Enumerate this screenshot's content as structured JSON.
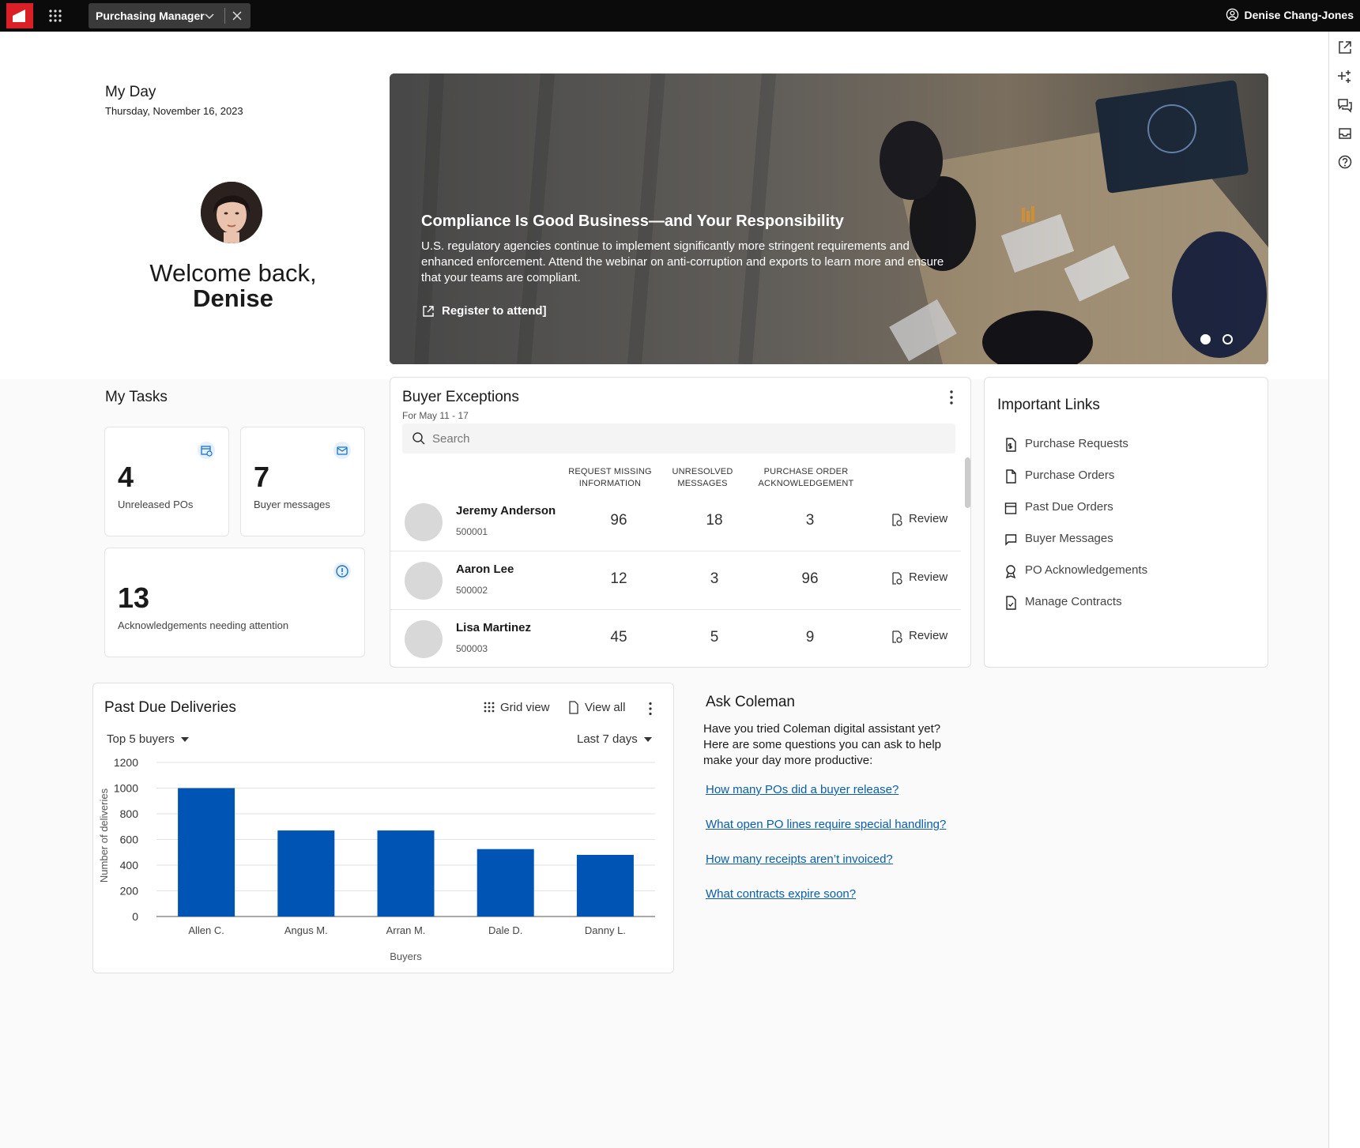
{
  "topbar": {
    "tab_label": "Purchasing Manager",
    "user_name": "Denise Chang-Jones"
  },
  "myday": {
    "title": "My Day",
    "date": "Thursday, November 16, 2023",
    "welcome_line": "Welcome back,",
    "welcome_name": "Denise"
  },
  "banner": {
    "title": "Compliance Is Good Business—and Your Responsibility",
    "body": "U.S. regulatory agencies continue to implement significantly more stringent requirements and enhanced enforcement. Attend the webinar on anti-corruption and exports to learn more and ensure that your teams are compliant.",
    "link": "Register to attend]",
    "active_slide": 1,
    "slide_count": 2
  },
  "tasks": {
    "title": "My Tasks",
    "items": [
      {
        "count": "4",
        "label": "Unreleased POs",
        "icon": "calendar-clock-icon"
      },
      {
        "count": "7",
        "label": "Buyer messages",
        "icon": "mail-icon"
      },
      {
        "count": "13",
        "label": "Acknowledgements needing attention",
        "icon": "info-icon"
      }
    ]
  },
  "buyer_exceptions": {
    "title": "Buyer Exceptions",
    "subtitle": "For May 11 - 17",
    "search_placeholder": "Search",
    "columns": [
      {
        "line1": "REQUEST MISSING",
        "line2": "INFORMATION"
      },
      {
        "line1": "UNRESOLVED",
        "line2": "MESSAGES"
      },
      {
        "line1": "PURCHASE ORDER",
        "line2": "ACKNOWLEDGEMENT"
      }
    ],
    "review_label": "Review",
    "rows": [
      {
        "name": "Jeremy Anderson",
        "id": "500001",
        "values": [
          "96",
          "18",
          "3"
        ]
      },
      {
        "name": "Aaron Lee",
        "id": "500002",
        "values": [
          "12",
          "3",
          "96"
        ]
      },
      {
        "name": "Lisa Martinez",
        "id": "500003",
        "values": [
          "45",
          "5",
          "9"
        ]
      }
    ]
  },
  "important_links": {
    "title": "Important Links",
    "items": [
      {
        "label": "Purchase Requests",
        "icon": "dollar-document-icon"
      },
      {
        "label": "Purchase Orders",
        "icon": "document-icon"
      },
      {
        "label": "Past Due Orders",
        "icon": "calendar-icon"
      },
      {
        "label": "Buyer Messages",
        "icon": "chat-icon"
      },
      {
        "label": "PO Acknowledgements",
        "icon": "ribbon-icon"
      },
      {
        "label": "Manage Contracts",
        "icon": "contract-icon"
      }
    ]
  },
  "past_due": {
    "title": "Past Due Deliveries",
    "grid_view": "Grid view",
    "view_all": "View all",
    "filter_left": "Top 5 buyers",
    "filter_right": "Last 7 days"
  },
  "chart_data": {
    "type": "bar",
    "categories": [
      "Allen C.",
      "Angus M.",
      "Arran M.",
      "Dale D.",
      "Danny L."
    ],
    "values": [
      1000,
      670,
      670,
      525,
      480
    ],
    "xlabel": "Buyers",
    "ylabel": "Number of deliveries",
    "ylim": [
      0,
      1200
    ],
    "yticks": [
      0,
      200,
      400,
      600,
      800,
      1000,
      1200
    ],
    "grid": true,
    "bar_color": "#0054b4"
  },
  "ask_coleman": {
    "title": "Ask Coleman",
    "body": "Have you tried Coleman digital assistant yet? Here are some questions you can ask to help make your day more productive:",
    "questions": [
      "How many POs did a buyer release?",
      "What open PO lines require special handling?",
      "How many receipts aren’t invoiced?",
      "What contracts expire soon?"
    ]
  },
  "colors": {
    "accent": "#da1f26",
    "link": "#0a5fa8",
    "info_blue": "#1a73c9"
  }
}
